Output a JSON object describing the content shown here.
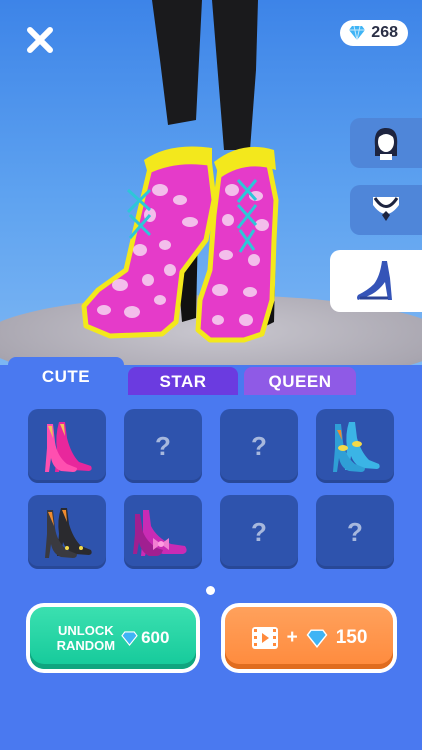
{
  "header": {
    "gem_count": "268"
  },
  "side_tabs": [
    {
      "name": "face",
      "icon": "face-icon",
      "active": false
    },
    {
      "name": "necklace",
      "icon": "necklace-icon",
      "active": false
    },
    {
      "name": "shoes",
      "icon": "high-heel-icon",
      "active": true
    }
  ],
  "tabs": [
    {
      "label": "CUTE",
      "active": true
    },
    {
      "label": "STAR",
      "active": false
    },
    {
      "label": "QUEEN",
      "active": false
    }
  ],
  "grid": {
    "locked_glyph": "?",
    "items": [
      {
        "type": "shoe",
        "icon": "pink-heels-icon",
        "locked": false
      },
      {
        "type": "locked",
        "locked": true
      },
      {
        "type": "locked",
        "locked": true
      },
      {
        "type": "shoe",
        "icon": "blue-heels-icon",
        "locked": false
      },
      {
        "type": "shoe",
        "icon": "black-heels-icon",
        "locked": false
      },
      {
        "type": "shoe",
        "icon": "bow-heels-icon",
        "locked": false
      },
      {
        "type": "locked",
        "locked": true
      },
      {
        "type": "locked",
        "locked": true
      }
    ]
  },
  "buttons": {
    "unlock_random_line1": "UNLOCK",
    "unlock_random_line2": "RANDOM",
    "unlock_random_price": "600",
    "video_plus": "+",
    "video_reward": "150"
  },
  "colors": {
    "background": "#4a79f0",
    "tab_star": "#6b3be0",
    "tab_queen": "#8f5ae6",
    "cell": "#2e53ad",
    "unlock_green": "#14c99a",
    "video_orange": "#ff8a3c",
    "boot_pink": "#e53bc9",
    "boot_yellow": "#f3e81c"
  }
}
